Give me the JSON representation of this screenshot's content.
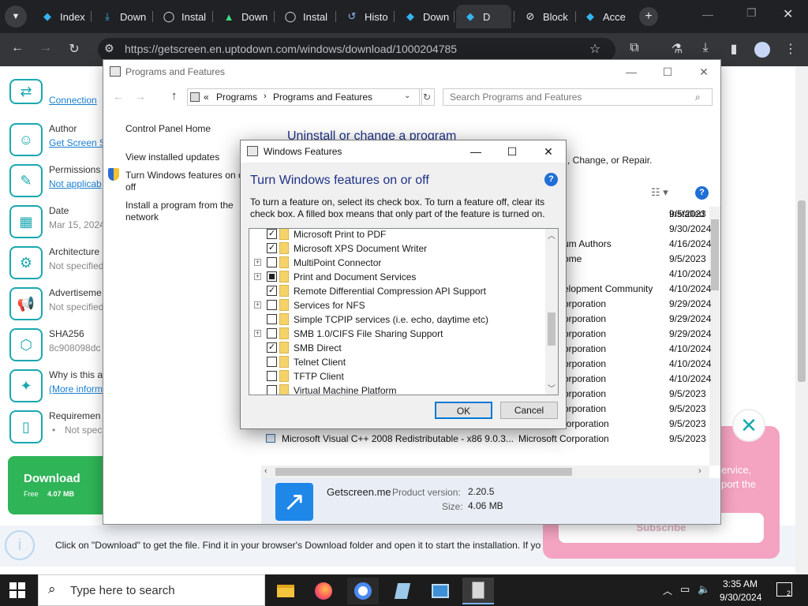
{
  "browser": {
    "tabs": [
      {
        "label": "Index",
        "icon": "uptodown-icon"
      },
      {
        "label": "Down",
        "icon": "download-icon"
      },
      {
        "label": "Instal",
        "icon": "github-icon"
      },
      {
        "label": "Down",
        "icon": "android-icon"
      },
      {
        "label": "Instal",
        "icon": "github-icon"
      },
      {
        "label": "Histo",
        "icon": "history-icon"
      },
      {
        "label": "Down",
        "icon": "uptodown-icon"
      },
      {
        "label": "D",
        "icon": "uptodown-icon"
      },
      {
        "label": "Block",
        "icon": "block-icon"
      },
      {
        "label": "Acce",
        "icon": "uptodown-icon"
      }
    ],
    "url": "https://getscreen.en.uptodown.com/windows/download/1000204785"
  },
  "page": {
    "sidebar": [
      {
        "title": "",
        "value": "Connection",
        "link": true
      },
      {
        "title": "Author",
        "value": "Get Screen S",
        "link": true
      },
      {
        "title": "Permissions",
        "value": "Not applicab",
        "link": true
      },
      {
        "title": "Date",
        "value": "Mar 15, 2024",
        "link": false
      },
      {
        "title": "Architecture",
        "value": "Not specified",
        "link": false
      },
      {
        "title": "Advertiseme",
        "value": "Not specified",
        "link": false
      },
      {
        "title": "SHA256",
        "value": "8c908098dc",
        "link": false
      },
      {
        "title": "Why is this a",
        "value": "(More inform",
        "link": true
      },
      {
        "title": "Requiremen",
        "value": "Not spec",
        "link": false
      }
    ],
    "download": {
      "label": "Download",
      "sub_free": "Free",
      "sub_size": "4.07 MB"
    },
    "bottom_text": "Click on \"Download\" to get the file. Find it in your browser's Download folder and open it to start the installation. If you",
    "ad": {
      "line1": "ervice,",
      "line2": "port the",
      "subscribe": "Subscribe"
    }
  },
  "programs_window": {
    "title": "Programs and Features",
    "breadcrumb": [
      "Programs",
      "Programs and Features"
    ],
    "search_placeholder": "Search Programs and Features",
    "left": {
      "home": "Control Panel Home",
      "updates": "View installed updates",
      "features_line1": "Turn Windows features on o",
      "features_line2": "off",
      "install_line1": "Install a program from the",
      "install_line2": "network"
    },
    "heading": "Uninstall or change a program",
    "subtext": ", Change, or Repair.",
    "col_installed": "Installed",
    "rows": [
      {
        "name": "",
        "publisher": "",
        "date": "9/5/2023"
      },
      {
        "name": "",
        "publisher": "",
        "date": "9/30/2024"
      },
      {
        "name": "",
        "publisher": "um Authors",
        "date": "4/16/2024"
      },
      {
        "name": "",
        "publisher": "ome",
        "date": "9/5/2023"
      },
      {
        "name": "",
        "publisher": "",
        "date": "4/10/2024"
      },
      {
        "name": "",
        "publisher": "elopment Community",
        "date": "4/10/2024"
      },
      {
        "name": "",
        "publisher": "orporation",
        "date": "9/29/2024"
      },
      {
        "name": "",
        "publisher": "orporation",
        "date": "9/29/2024"
      },
      {
        "name": "",
        "publisher": "orporation",
        "date": "9/29/2024"
      },
      {
        "name": "",
        "publisher": "orporation",
        "date": "4/10/2024"
      },
      {
        "name": "",
        "publisher": "orporation",
        "date": "4/10/2024"
      },
      {
        "name": "",
        "publisher": "orporation",
        "date": "4/10/2024"
      },
      {
        "name": "",
        "publisher": "orporation",
        "date": "9/5/2023"
      },
      {
        "name": "",
        "publisher": "orporation",
        "date": "9/5/2023"
      },
      {
        "name": "Microsoft Visual C++ 2008 Redistributable - x64 9.0.3...",
        "publisher": "Microsoft Corporation",
        "date": "9/5/2023"
      },
      {
        "name": "Microsoft Visual C++ 2008 Redistributable - x86 9.0.3...",
        "publisher": "Microsoft Corporation",
        "date": "9/5/2023"
      }
    ],
    "details": {
      "name": "Getscreen.me",
      "version_label": "Product version:",
      "version": "2.20.5",
      "size_label": "Size:",
      "size": "4.06 MB"
    }
  },
  "features_dialog": {
    "title": "Windows Features",
    "heading": "Turn Windows features on or off",
    "help": "?",
    "description": "To turn a feature on, select its check box. To turn a feature off, clear its check box. A filled box means that only part of the feature is turned on.",
    "features": [
      {
        "label": "Microsoft Print to PDF",
        "state": "checked",
        "expandable": false
      },
      {
        "label": "Microsoft XPS Document Writer",
        "state": "checked",
        "expandable": false
      },
      {
        "label": "MultiPoint Connector",
        "state": "unchecked",
        "expandable": true
      },
      {
        "label": "Print and Document Services",
        "state": "partial",
        "expandable": true
      },
      {
        "label": "Remote Differential Compression API Support",
        "state": "checked",
        "expandable": false
      },
      {
        "label": "Services for NFS",
        "state": "unchecked",
        "expandable": true
      },
      {
        "label": "Simple TCPIP services (i.e. echo, daytime etc)",
        "state": "unchecked",
        "expandable": false
      },
      {
        "label": "SMB 1.0/CIFS File Sharing Support",
        "state": "unchecked",
        "expandable": true
      },
      {
        "label": "SMB Direct",
        "state": "checked",
        "expandable": false
      },
      {
        "label": "Telnet Client",
        "state": "unchecked",
        "expandable": false
      },
      {
        "label": "TFTP Client",
        "state": "unchecked",
        "expandable": false
      },
      {
        "label": "Virtual Machine Platform",
        "state": "unchecked",
        "expandable": false
      }
    ],
    "ok": "OK",
    "cancel": "Cancel"
  },
  "taskbar": {
    "search_placeholder": "Type here to search",
    "time": "3:35 AM",
    "date": "9/30/2024",
    "notification_count": "2"
  }
}
